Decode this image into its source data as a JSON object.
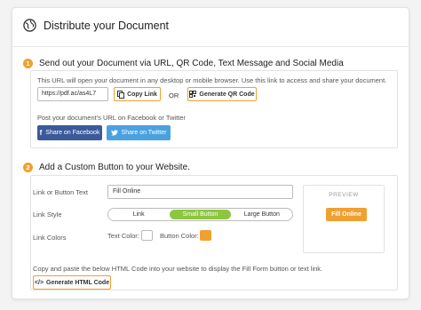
{
  "header": {
    "title": "Distribute your Document",
    "icon": "globe-icon"
  },
  "step1": {
    "number": "1",
    "title": "Send out your Document via URL, QR Code, Text Message and Social Media",
    "description": "This URL will open your document in any desktop or mobile browser. Use this link to access and share your document.",
    "url_value": "https://pdf.ac/as4L7",
    "copy_label": "Copy Link",
    "or_label": "OR",
    "qr_label": "Generate QR Code",
    "social_text": "Post your document's URL on Facebook or Twitter",
    "facebook_label": "Share on Facebook",
    "twitter_label": "Share on Twitter"
  },
  "step2": {
    "number": "2",
    "title": "Add a Custom Button to your Website.",
    "link_text_label": "Link or Button Text",
    "link_text_value": "Fill Online",
    "link_style_label": "Link Style",
    "style_options": [
      "Link",
      "Small Button",
      "Large Button"
    ],
    "link_colors_label": "Link Colors",
    "text_color_label": "Text Color:",
    "button_color_label": "Button Color:",
    "preview_label": "PREVIEW",
    "preview_button": "Fill Online",
    "html_description": "Copy and paste the below HTML Code into your website to display the Fill Form button or text link.",
    "html_button": "Generate HTML Code"
  },
  "colors": {
    "accent": "#f0a030",
    "active_style": "#8dc63f",
    "facebook": "#3b5a9a",
    "twitter": "#4aa1e0",
    "text_color_swatch": "#ffffff",
    "button_color_swatch": "#f0a030"
  }
}
